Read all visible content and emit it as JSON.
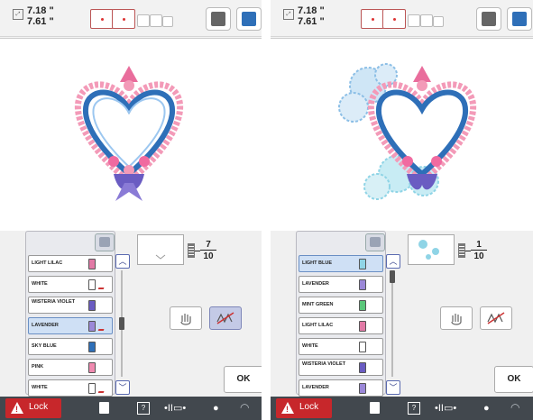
{
  "colors": {
    "accent": "#2e6fb8",
    "lock": "#c7272b",
    "bottom_bar": "#42484e",
    "selected": "#cfe0f5"
  },
  "left_panel": {
    "dims": {
      "w": "7.18 \"",
      "h": "7.61 \""
    },
    "counter": {
      "current": "7",
      "total": "10"
    },
    "ok_label": "OK",
    "lock_label": "Lock",
    "threads": [
      {
        "name": "LIGHT LILAC",
        "color": "#e27aa6",
        "selected": false,
        "cut": false
      },
      {
        "name": "WHITE",
        "color": "#ffffff",
        "selected": false,
        "cut": true
      },
      {
        "name": "WISTERIA VIOLET",
        "color": "#6a5cc2",
        "selected": false,
        "cut": false
      },
      {
        "name": "LAVENDER",
        "color": "#9b88d8",
        "selected": true,
        "cut": true
      },
      {
        "name": "SKY BLUE",
        "color": "#2e6fb8",
        "selected": false,
        "cut": false
      },
      {
        "name": "PINK",
        "color": "#f08ab0",
        "selected": false,
        "cut": false
      },
      {
        "name": "WHITE",
        "color": "#ffffff",
        "selected": false,
        "cut": true
      }
    ]
  },
  "right_panel": {
    "dims": {
      "w": "7.18 \"",
      "h": "7.61 \""
    },
    "counter": {
      "current": "1",
      "total": "10"
    },
    "ok_label": "OK",
    "lock_label": "Lock",
    "threads": [
      {
        "name": "LIGHT BLUE",
        "color": "#8fd4e6",
        "selected": true,
        "cut": false
      },
      {
        "name": "LAVENDER",
        "color": "#9b88d8",
        "selected": false,
        "cut": false
      },
      {
        "name": "MINT GREEN",
        "color": "#5ac77a",
        "selected": false,
        "cut": false
      },
      {
        "name": "LIGHT LILAC",
        "color": "#e27aa6",
        "selected": false,
        "cut": false
      },
      {
        "name": "WHITE",
        "color": "#ffffff",
        "selected": false,
        "cut": false
      },
      {
        "name": "WISTERIA VIOLET",
        "color": "#6a5cc2",
        "selected": false,
        "cut": false
      },
      {
        "name": "LAVENDER",
        "color": "#9b88d8",
        "selected": false,
        "cut": false
      }
    ]
  },
  "icons": [
    "size-icon",
    "hoop-icon",
    "embroidery-frame-icon",
    "home-icon",
    "thread-tool-icon",
    "hand-icon",
    "trim-icon",
    "scroll-up-icon",
    "scroll-down-icon",
    "warning-icon",
    "page-icon",
    "help-icon",
    "needle-icon",
    "clock-icon",
    "wifi-icon"
  ]
}
